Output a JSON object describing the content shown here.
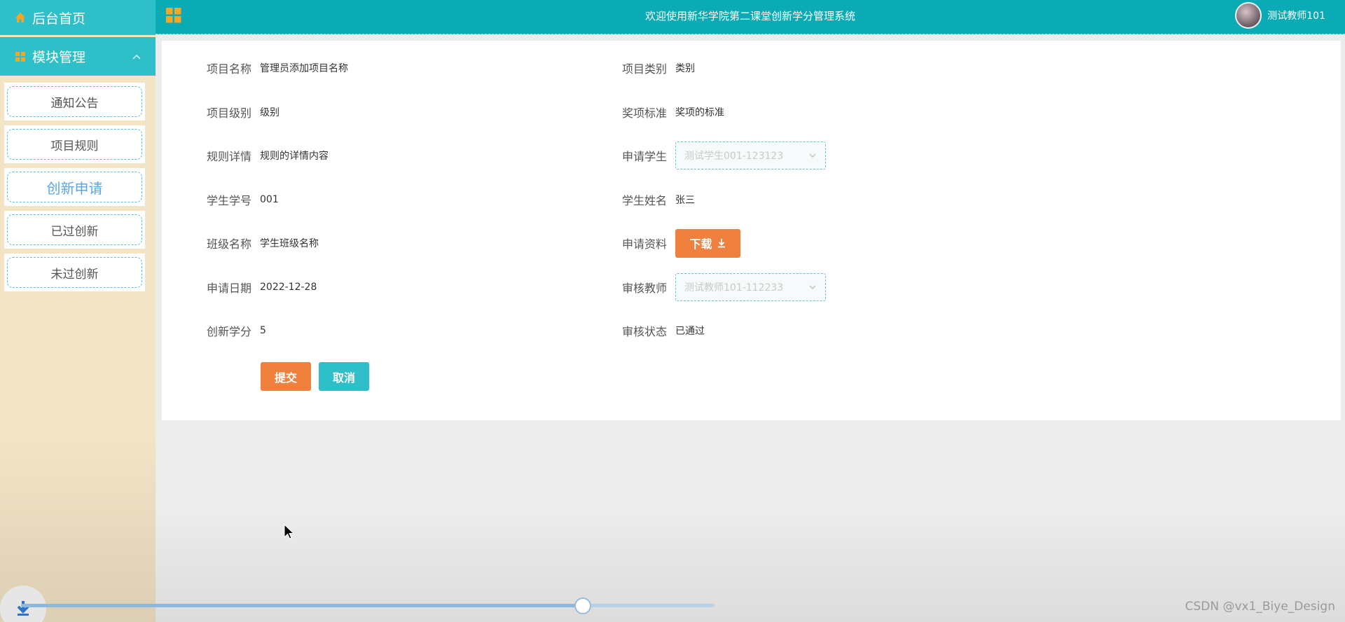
{
  "sidebar": {
    "home_label": "后台首页",
    "module_label": "模块管理",
    "items": [
      {
        "label": "通知公告"
      },
      {
        "label": "项目规则"
      },
      {
        "label": "创新申请"
      },
      {
        "label": "已过创新"
      },
      {
        "label": "未过创新"
      }
    ]
  },
  "header": {
    "title": "欢迎使用新华学院第二课堂创新学分管理系统",
    "user_name": "测试教师101"
  },
  "form": {
    "project_name": {
      "label": "项目名称",
      "value": "管理员添加项目名称"
    },
    "project_category": {
      "label": "项目类别",
      "value": "类别"
    },
    "project_level": {
      "label": "项目级别",
      "value": "级别"
    },
    "award_standard": {
      "label": "奖项标准",
      "value": "奖项的标准"
    },
    "rule_details": {
      "label": "规则详情",
      "value": "规则的详情内容"
    },
    "applicant_student": {
      "label": "申请学生",
      "value": "测试学生001-123123"
    },
    "student_id": {
      "label": "学生学号",
      "value": "001"
    },
    "student_name": {
      "label": "学生姓名",
      "value": "张三"
    },
    "class_name": {
      "label": "班级名称",
      "value": "学生班级名称"
    },
    "application_material": {
      "label": "申请资料",
      "button": "下载"
    },
    "apply_date": {
      "label": "申请日期",
      "value": "2022-12-28"
    },
    "review_teacher": {
      "label": "审核教师",
      "value": "测试教师101-112233"
    },
    "credits": {
      "label": "创新学分",
      "value": "5"
    },
    "review_status": {
      "label": "审核状态",
      "value": "已通过"
    },
    "submit_label": "提交",
    "cancel_label": "取消"
  },
  "player": {
    "progress": 0.81
  },
  "watermark": "CSDN @vx1_Biye_Design",
  "colors": {
    "primary": "#0aabb4",
    "accent_orange": "#f0803e",
    "sidebar_bg": "#f3e4c6"
  }
}
